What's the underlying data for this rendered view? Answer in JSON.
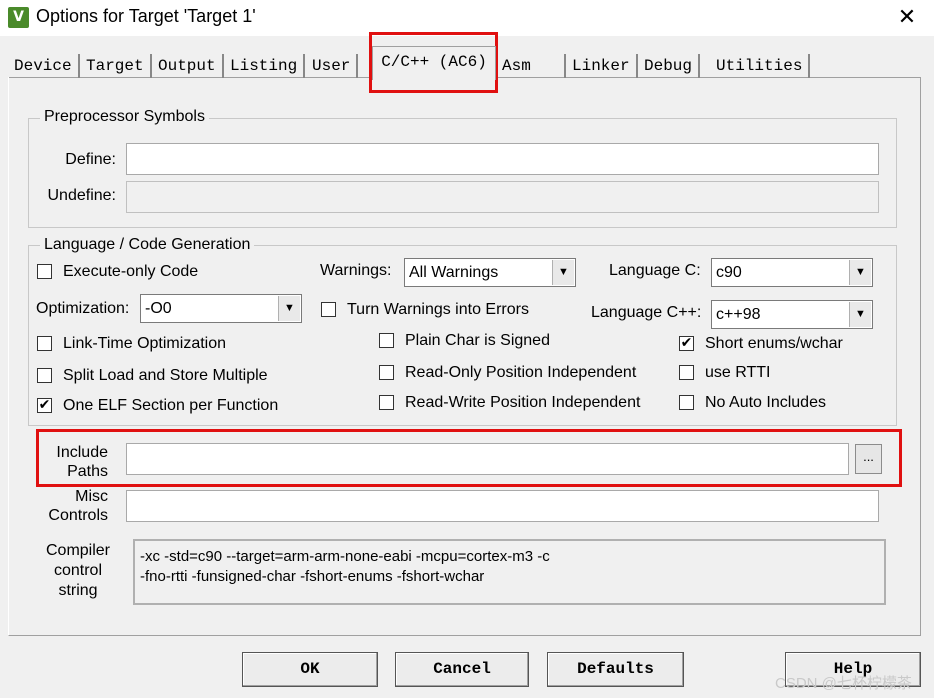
{
  "window": {
    "title": "Options for Target 'Target 1'",
    "app_icon": "keil-uvision-icon",
    "close_glyph": "✕"
  },
  "tabs": [
    {
      "label": "Device"
    },
    {
      "label": "Target"
    },
    {
      "label": "Output"
    },
    {
      "label": "Listing"
    },
    {
      "label": "User"
    },
    {
      "label": "C/C++ (AC6)"
    },
    {
      "label": "Asm"
    },
    {
      "label": "Linker"
    },
    {
      "label": "Debug"
    },
    {
      "label": "Utilities"
    }
  ],
  "preprocessor": {
    "title": "Preprocessor Symbols",
    "define_label": "Define:",
    "define_value": "",
    "undefine_label": "Undefine:",
    "undefine_value": ""
  },
  "language": {
    "title": "Language / Code Generation",
    "execute_only": {
      "label": "Execute-only Code",
      "checked": false
    },
    "optimization_label": "Optimization:",
    "optimization_value": "-O0",
    "link_time_opt": {
      "label": "Link-Time Optimization",
      "checked": false
    },
    "split_load": {
      "label": "Split Load and Store Multiple",
      "checked": false
    },
    "one_elf": {
      "label": "One ELF Section per Function",
      "checked": true
    },
    "warnings_label": "Warnings:",
    "warnings_value": "All Warnings",
    "turn_warnings": {
      "label": "Turn Warnings into Errors",
      "checked": false
    },
    "plain_char": {
      "label": "Plain Char is Signed",
      "checked": false
    },
    "ro_pi": {
      "label": "Read-Only Position Independent",
      "checked": false
    },
    "rw_pi": {
      "label": "Read-Write Position Independent",
      "checked": false
    },
    "language_c_label": "Language C:",
    "language_c_value": "c90",
    "language_cpp_label": "Language C++:",
    "language_cpp_value": "c++98",
    "short_enums": {
      "label": "Short enums/wchar",
      "checked": true
    },
    "use_rtti": {
      "label": "use RTTI",
      "checked": false
    },
    "no_auto_includes": {
      "label": "No Auto Includes",
      "checked": false
    }
  },
  "include_paths": {
    "label_line1": "Include",
    "label_line2": "Paths",
    "value": "",
    "browse_label": "..."
  },
  "misc_controls": {
    "label_line1": "Misc",
    "label_line2": "Controls",
    "value": ""
  },
  "compiler_string": {
    "label_line1": "Compiler",
    "label_line2": "control",
    "label_line3": "string",
    "line1": "-xc -std=c90 --target=arm-arm-none-eabi -mcpu=cortex-m3 -c",
    "line2": "-fno-rtti -funsigned-char -fshort-enums -fshort-wchar"
  },
  "buttons": {
    "ok": "OK",
    "cancel": "Cancel",
    "defaults": "Defaults",
    "help": "Help"
  },
  "watermark": "CSDN @七杯柠檬茶",
  "colors": {
    "highlight": "#e01010",
    "dialog_bg": "#f0f0f0"
  }
}
